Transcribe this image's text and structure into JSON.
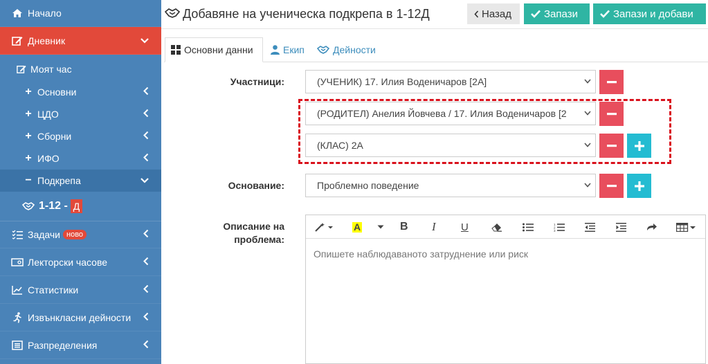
{
  "sidebar": {
    "home": "Начало",
    "diary": "Дневник",
    "my_hour": "Моят час",
    "sub_items": [
      "Основни",
      "ЦДО",
      "Сборни",
      "ИФО"
    ],
    "support": "Подкрепа",
    "class_code": "1-12 -",
    "class_letter": "Д",
    "tasks": "Задачи",
    "tasks_badge": "ново",
    "lector": "Лекторски часове",
    "stats": "Статистики",
    "extra": "Извънкласни дейности",
    "distribution": "Разпределения"
  },
  "header": {
    "title": "Добавяне на ученическа подкрепа в 1-12Д",
    "back": "Назад",
    "save": "Запази",
    "save_add": "Запази и добави"
  },
  "tabs": {
    "basic": "Основни данни",
    "team": "Екип",
    "activities": "Дейности"
  },
  "form": {
    "participants_label": "Участници:",
    "participant_1": "(УЧЕНИК) 17. Илия Воденичаров [2А]",
    "participant_2": "(РОДИТЕЛ) Анелия Йовчева / 17. Илия Воденичаров [2",
    "participant_3": "(КЛАС) 2А",
    "reason_label": "Основание:",
    "reason": "Проблемно поведение",
    "desc_label_1": "Описание на",
    "desc_label_2": "проблема:",
    "desc_placeholder": "Опишете наблюдаваното затруднение или риск"
  },
  "colors": {
    "sidebar": "#4a83b8",
    "active": "#e2493a",
    "teal": "#2fb5a3",
    "minus": "#e84e5d",
    "plus": "#24bcd2",
    "highlight": "#d9111c"
  }
}
